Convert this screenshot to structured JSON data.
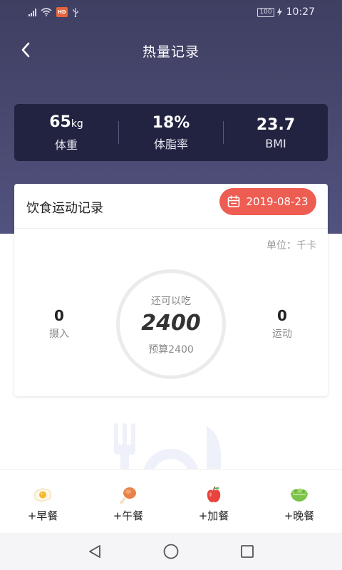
{
  "status_bar": {
    "carrier_badge": "HD",
    "battery": "100",
    "time": "10:27",
    "icons": [
      "signal-icon",
      "wifi-icon",
      "usb-icon",
      "charging-icon"
    ]
  },
  "header": {
    "title": "热量记录",
    "back_icon": "chevron-left-icon"
  },
  "stats": [
    {
      "value": "65",
      "unit": "kg",
      "label": "体重"
    },
    {
      "value": "18%",
      "unit": "",
      "label": "体脂率"
    },
    {
      "value": "23.7",
      "unit": "",
      "label": "BMI"
    }
  ],
  "card": {
    "title": "饮食运动记录",
    "date": "2019-08-23",
    "date_icon": "calendar-icon",
    "unit_label": "单位：千卡",
    "intake": {
      "value": "0",
      "label": "摄入"
    },
    "exercise": {
      "value": "0",
      "label": "运动"
    },
    "ring": {
      "top_label": "还可以吃",
      "value": "2400",
      "budget_label": "预算2400"
    }
  },
  "meals": [
    {
      "label": "+早餐",
      "icon": "fried-egg-icon"
    },
    {
      "label": "+午餐",
      "icon": "chicken-leg-icon"
    },
    {
      "label": "+加餐",
      "icon": "apple-icon"
    },
    {
      "label": "+晚餐",
      "icon": "salad-bowl-icon"
    }
  ],
  "colors": {
    "header_bg": "#45456b",
    "stats_bg": "#222341",
    "accent": "#ee5d52"
  }
}
